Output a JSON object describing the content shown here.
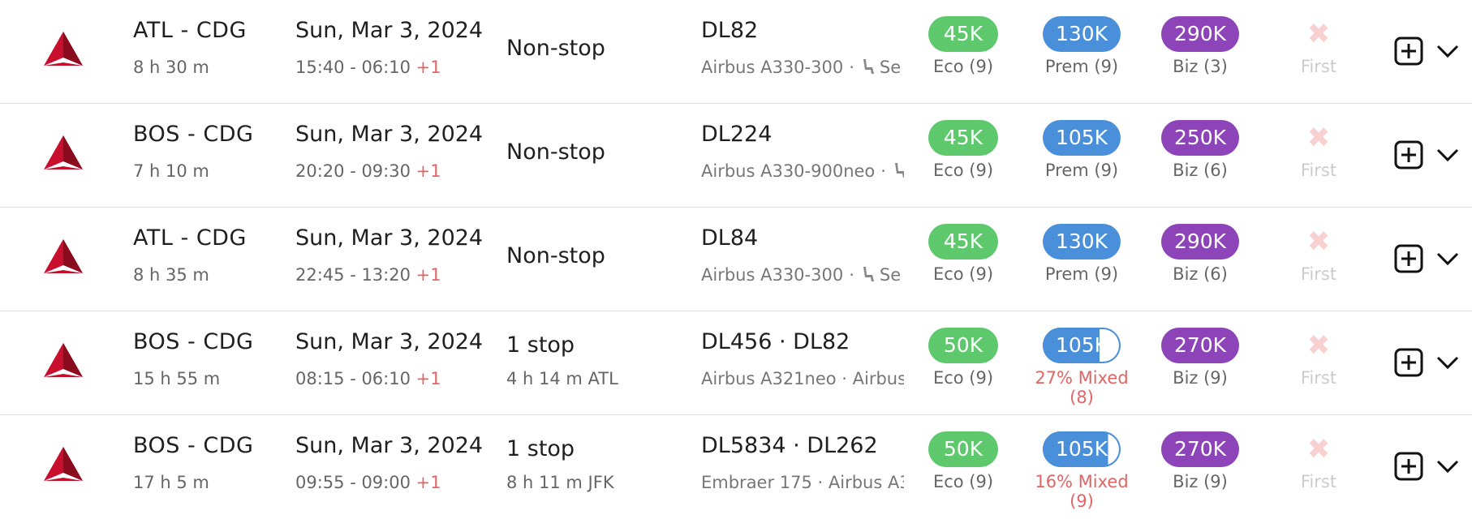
{
  "colors": {
    "eco": "#5dc86c",
    "prem": "#4a8fd9",
    "biz": "#8c44b8",
    "first_disabled": "#f8d0d0",
    "plus_day": "#e06666",
    "mixed_text": "#e06666"
  },
  "icons": {
    "airline_logo": "delta-logo-icon",
    "seat": "seat-icon",
    "add": "plus-square-icon",
    "expand": "chevron-down-icon",
    "unavailable": "x-icon"
  },
  "flights": [
    {
      "route": "ATL - CDG",
      "duration": "8 h 30 m",
      "date": "Sun, Mar 3, 2024",
      "times": "15:40 - 06:10",
      "day_offset": "+1",
      "stops": "Non-stop",
      "layover": "",
      "flight_numbers": "DL82",
      "aircraft": "Airbus A330-300",
      "aircraft_extra": "Se",
      "eco": {
        "price": "45K",
        "label": "Eco (9)"
      },
      "prem": {
        "price": "130K",
        "label": "Prem (9)"
      },
      "biz": {
        "price": "290K",
        "label": "Biz (3)"
      },
      "first": {
        "symbol": "✖",
        "label": "First"
      }
    },
    {
      "route": "BOS - CDG",
      "duration": "7 h 10 m",
      "date": "Sun, Mar 3, 2024",
      "times": "20:20 - 09:30",
      "day_offset": "+1",
      "stops": "Non-stop",
      "layover": "",
      "flight_numbers": "DL224",
      "aircraft": "Airbus A330-900neo",
      "aircraft_extra": "",
      "eco": {
        "price": "45K",
        "label": "Eco (9)"
      },
      "prem": {
        "price": "105K",
        "label": "Prem (9)"
      },
      "biz": {
        "price": "250K",
        "label": "Biz (6)"
      },
      "first": {
        "symbol": "✖",
        "label": "First"
      }
    },
    {
      "route": "ATL - CDG",
      "duration": "8 h 35 m",
      "date": "Sun, Mar 3, 2024",
      "times": "22:45 - 13:20",
      "day_offset": "+1",
      "stops": "Non-stop",
      "layover": "",
      "flight_numbers": "DL84",
      "aircraft": "Airbus A330-300",
      "aircraft_extra": "Se",
      "eco": {
        "price": "45K",
        "label": "Eco (9)"
      },
      "prem": {
        "price": "130K",
        "label": "Prem (9)"
      },
      "biz": {
        "price": "290K",
        "label": "Biz (6)"
      },
      "first": {
        "symbol": "✖",
        "label": "First"
      }
    },
    {
      "route": "BOS - CDG",
      "duration": "15 h 55 m",
      "date": "Sun, Mar 3, 2024",
      "times": "08:15 - 06:10",
      "day_offset": "+1",
      "stops": "1 stop",
      "layover": "4 h 14 m  ATL",
      "flight_numbers": "DL456 · DL82",
      "aircraft": "Airbus A321neo · Airbus",
      "aircraft_extra": "",
      "eco": {
        "price": "50K",
        "label": "Eco (9)"
      },
      "prem": {
        "price": "105K",
        "label": "27% Mixed (8)",
        "mixed": true,
        "mixed_fraction": 0.73
      },
      "biz": {
        "price": "270K",
        "label": "Biz (9)"
      },
      "first": {
        "symbol": "✖",
        "label": "First"
      }
    },
    {
      "route": "BOS - CDG",
      "duration": "17 h 5 m",
      "date": "Sun, Mar 3, 2024",
      "times": "09:55 - 09:00",
      "day_offset": "+1",
      "stops": "1 stop",
      "layover": "8 h 11 m  JFK",
      "flight_numbers": "DL5834 · DL262",
      "aircraft": "Embraer 175 · Airbus A3",
      "aircraft_extra": "",
      "eco": {
        "price": "50K",
        "label": "Eco (9)"
      },
      "prem": {
        "price": "105K",
        "label": "16% Mixed (9)",
        "mixed": true,
        "mixed_fraction": 0.84
      },
      "biz": {
        "price": "270K",
        "label": "Biz (9)"
      },
      "first": {
        "symbol": "✖",
        "label": "First"
      }
    }
  ]
}
